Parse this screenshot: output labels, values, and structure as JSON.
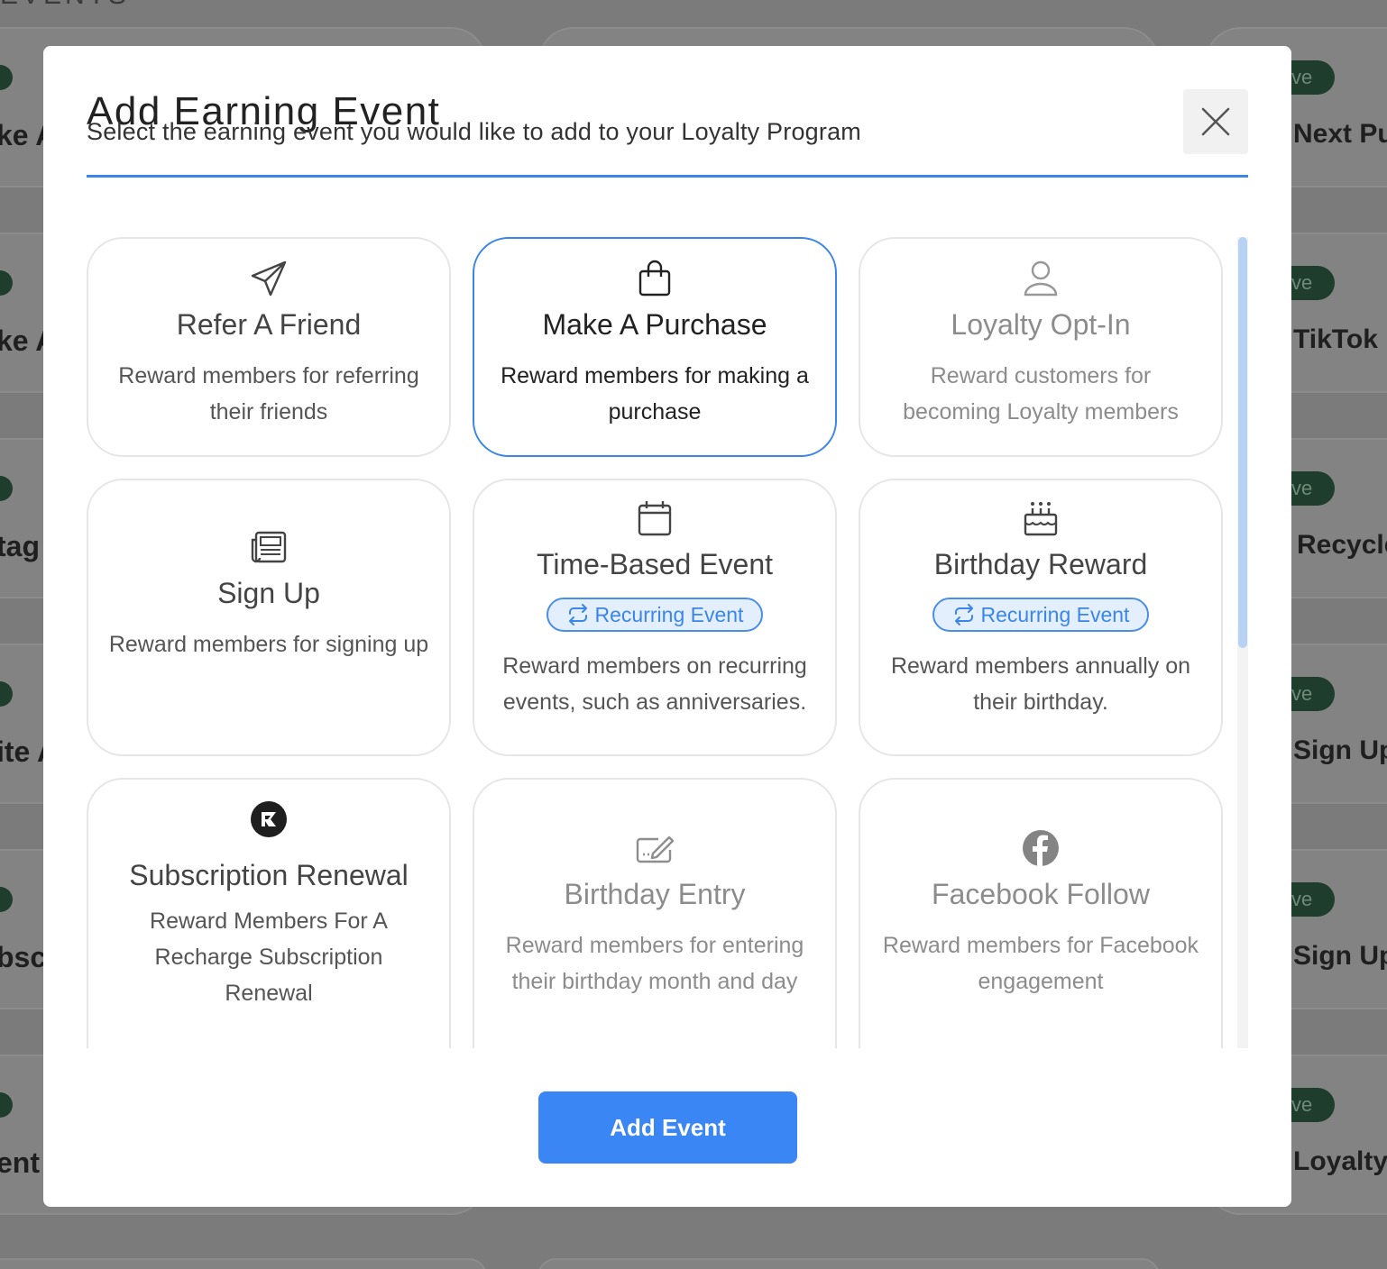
{
  "background": {
    "header_fragment": "EVENTS",
    "left_fragments": [
      "ke A",
      "ke A",
      "tag",
      "ite A",
      "bsc",
      "ent"
    ],
    "status_pill": "ve",
    "right_fragments": [
      "Next Pu",
      "TikTok",
      "Recycle",
      "Sign Up",
      "Sign Up",
      "Loyalty"
    ]
  },
  "modal": {
    "title": "Add Earning Event",
    "subtitle": "Select the earning event you would like to add to your Loyalty Program",
    "close_icon": "close-icon",
    "add_button_label": "Add Event",
    "accent_color": "#3b86e8"
  },
  "events": [
    {
      "icon": "paper-plane-icon",
      "title": "Refer A Friend",
      "desc": "Reward members for referring their friends",
      "state": "normal"
    },
    {
      "icon": "shopping-bag-icon",
      "title": "Make A Purchase",
      "desc": "Reward members for making a purchase",
      "state": "selected"
    },
    {
      "icon": "user-icon",
      "title": "Loyalty Opt-In",
      "desc": "Reward customers for becoming Loyalty members",
      "state": "disabled"
    },
    {
      "icon": "newspaper-icon",
      "title": "Sign Up",
      "desc": "Reward members for signing up",
      "state": "normal"
    },
    {
      "icon": "calendar-icon",
      "title": "Time-Based Event",
      "badge": "Recurring Event",
      "desc": "Reward members on recurring events, such as anniversaries.",
      "state": "normal"
    },
    {
      "icon": "birthday-cake-icon",
      "title": "Birthday Reward",
      "badge": "Recurring Event",
      "desc": "Reward members annually on their birthday.",
      "state": "normal"
    },
    {
      "icon": "recharge-logo-icon",
      "title": "Subscription Renewal",
      "desc": "Reward Members For A Recharge Subscription Renewal",
      "state": "normal"
    },
    {
      "icon": "edit-form-icon",
      "title": "Birthday Entry",
      "desc": "Reward members for entering their birthday month and day",
      "state": "disabled"
    },
    {
      "icon": "facebook-icon",
      "title": "Facebook Follow",
      "desc": "Reward members for Facebook engagement",
      "state": "disabled"
    }
  ]
}
